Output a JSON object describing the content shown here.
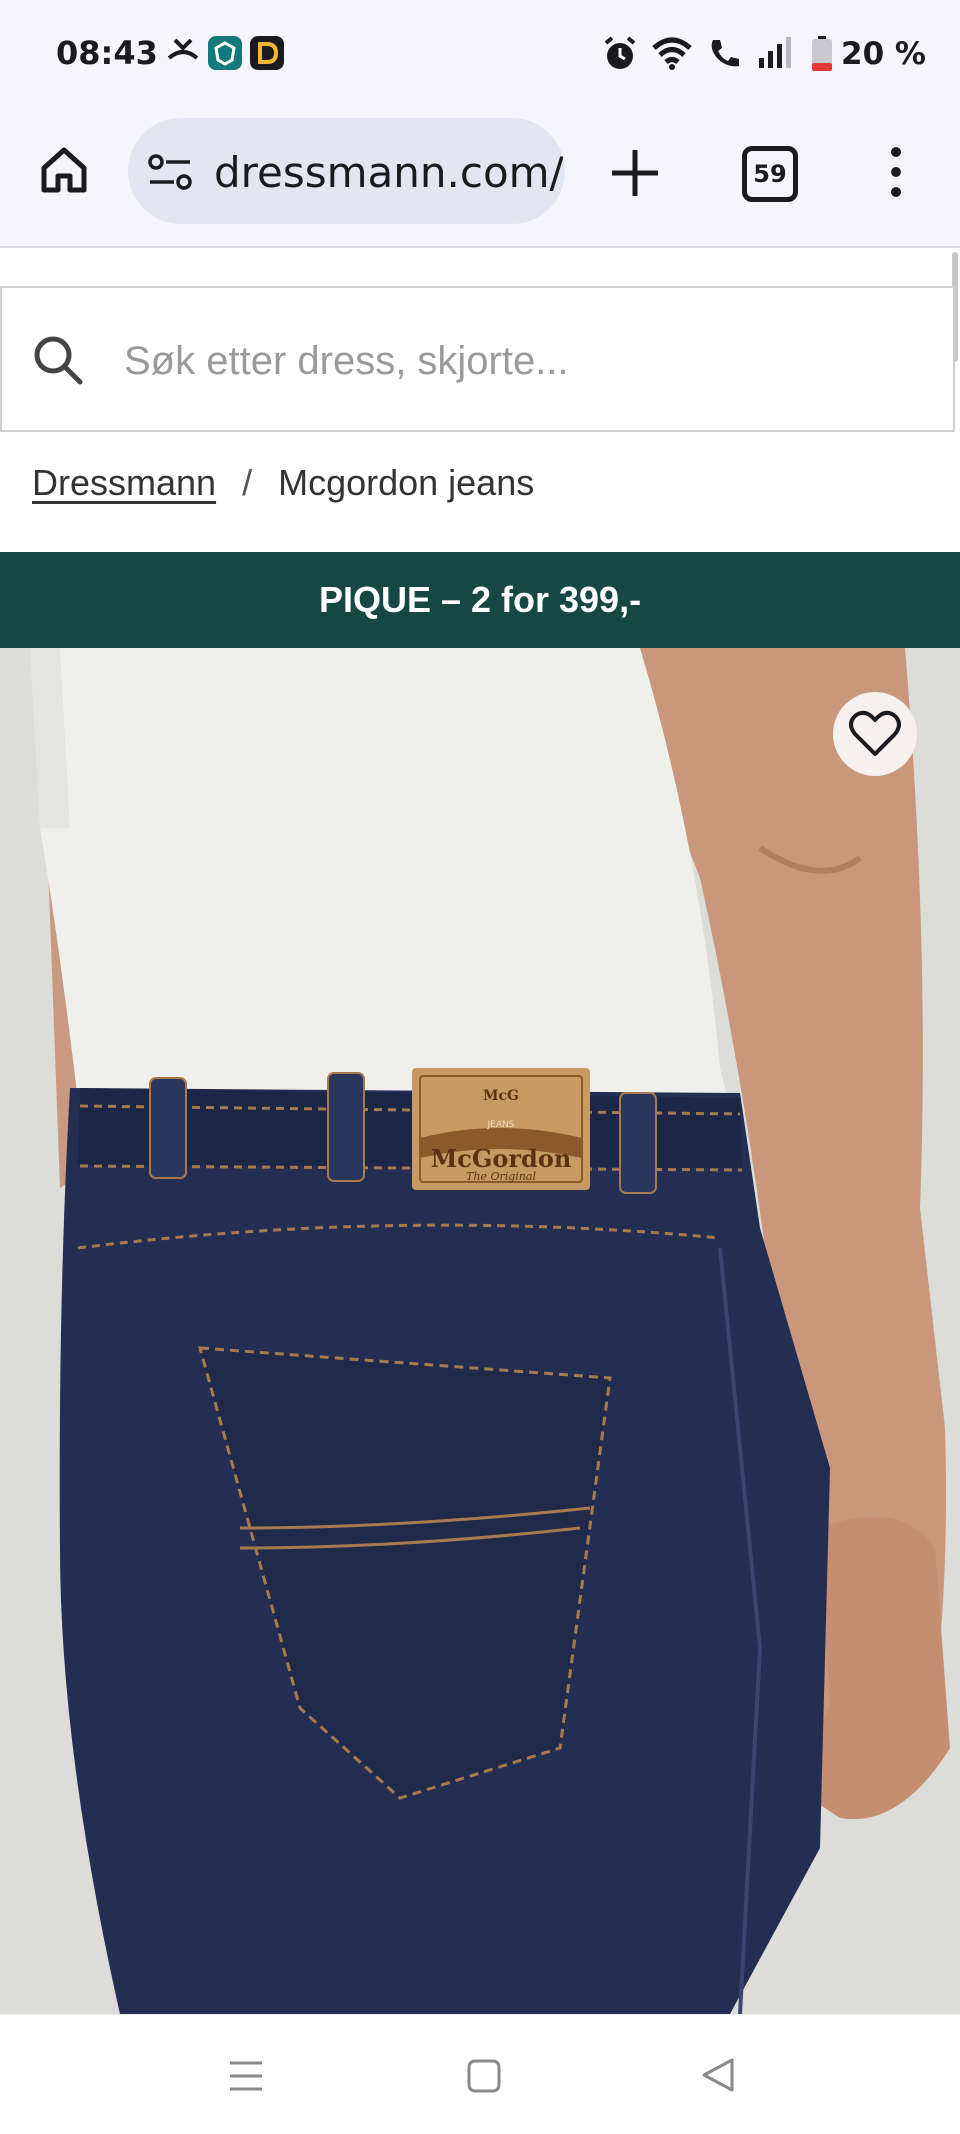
{
  "status_bar": {
    "time": "08:43",
    "battery_percent": "20 %",
    "icons": [
      "missed-call-icon",
      "app-icon",
      "d-app-icon",
      "alarm-icon",
      "wifi-icon",
      "call-icon",
      "signal-icon",
      "battery-icon"
    ]
  },
  "browser": {
    "url": "dressmann.com/n",
    "tab_count": "59",
    "icons": [
      "home-icon",
      "site-info-icon",
      "new-tab-icon",
      "tabs-icon",
      "menu-icon"
    ]
  },
  "search": {
    "placeholder": "Søk etter dress, skjorte..."
  },
  "breadcrumb": {
    "home": "Dressmann",
    "separator": "/",
    "current": "Mcgordon jeans"
  },
  "promo": {
    "text": "PIQUE – 2 for 399,-"
  },
  "product": {
    "label_brand": "McGordon",
    "label_sub": "The Original",
    "label_monogram": "McG",
    "label_jeans": "JEANS",
    "colors": {
      "denim": "#1f2a4a",
      "shirt": "#f0f0ee",
      "background": "#dcdcd8",
      "skin": "#c9977b",
      "banner": "#154743"
    }
  },
  "nav": {
    "icons": [
      "recents-icon",
      "home-nav-icon",
      "back-icon"
    ]
  }
}
